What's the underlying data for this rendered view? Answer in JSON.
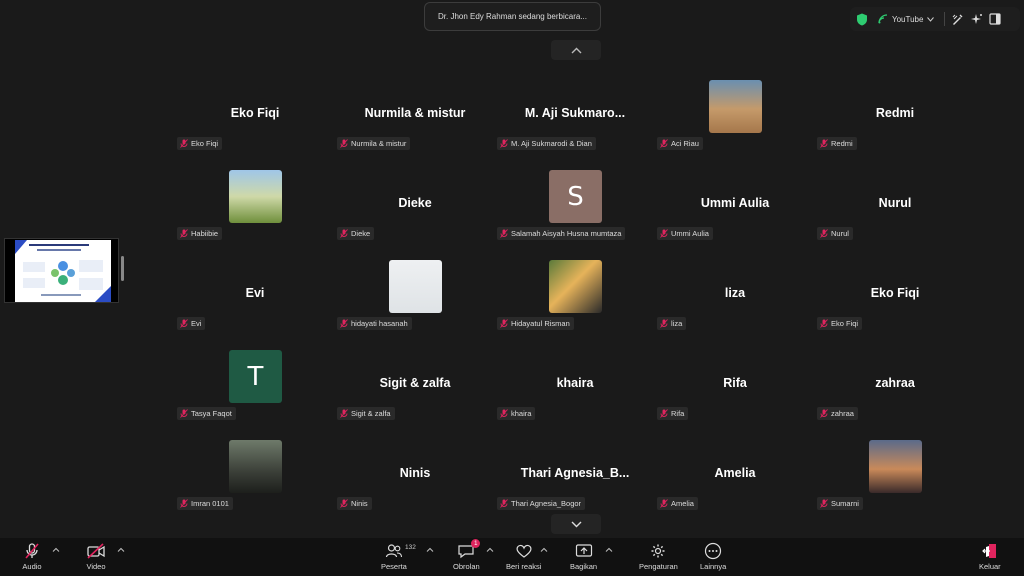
{
  "speaking_banner": "Dr. Jhon Edy Rahman sedang berbicara...",
  "top_bar": {
    "youtube_label": "YouTube"
  },
  "tiles": [
    {
      "name": "Eko Fiqi",
      "label": "Eko Fiqi",
      "avatar": "none"
    },
    {
      "name": "Nurmila & mistur",
      "label": "Nurmila & mistur",
      "avatar": "none"
    },
    {
      "name": "M. Aji Sukmaro...",
      "label": "M. Aji Sukmarodi & Dian",
      "avatar": "none"
    },
    {
      "name": "",
      "label": "Aci Riau",
      "avatar": "photo"
    },
    {
      "name": "Redmi",
      "label": "Redmi",
      "avatar": "none"
    },
    {
      "name": "",
      "label": "Habiibie",
      "avatar": "photo"
    },
    {
      "name": "Dieke",
      "label": "Dieke",
      "avatar": "none"
    },
    {
      "name": "",
      "label": "Salamah Aisyah Husna mumtaza",
      "avatar": "initial",
      "initial": "S",
      "color": "#8a6e66"
    },
    {
      "name": "Ummi Aulia",
      "label": "Ummi Aulia",
      "avatar": "none"
    },
    {
      "name": "Nurul",
      "label": "Nurul",
      "avatar": "none"
    },
    {
      "name": "Evi",
      "label": "Evi",
      "avatar": "none"
    },
    {
      "name": "",
      "label": "hidayati hasanah",
      "avatar": "photo"
    },
    {
      "name": "",
      "label": "Hidayatul Risman",
      "avatar": "photo"
    },
    {
      "name": "liza",
      "label": "liza",
      "avatar": "none"
    },
    {
      "name": "Eko Fiqi",
      "label": "Eko Fiqi",
      "avatar": "none"
    },
    {
      "name": "",
      "label": "Tasya Faqot",
      "avatar": "initial",
      "initial": "T",
      "color": "#1f5a44"
    },
    {
      "name": "Sigit & zalfa",
      "label": "Sigit & zalfa",
      "avatar": "none"
    },
    {
      "name": "khaira",
      "label": "khaira",
      "avatar": "none"
    },
    {
      "name": "Rifa",
      "label": "Rifa",
      "avatar": "none"
    },
    {
      "name": "zahraa",
      "label": "zahraa",
      "avatar": "none"
    },
    {
      "name": "",
      "label": "Imran 0101",
      "avatar": "photo"
    },
    {
      "name": "Ninis",
      "label": "Ninis",
      "avatar": "none"
    },
    {
      "name": "Thari  Agnesia_B...",
      "label": "Thari Agnesia_Bogor",
      "avatar": "none"
    },
    {
      "name": "Amelia",
      "label": "Amelia",
      "avatar": "none"
    },
    {
      "name": "",
      "label": "Sumarni",
      "avatar": "photo"
    }
  ],
  "toolbar": {
    "audio": "Audio",
    "video": "Video",
    "participants": "Peserta",
    "participant_count": "132",
    "chat": "Obrolan",
    "chat_badge": "1",
    "react": "Beri reaksi",
    "share": "Bagikan",
    "settings": "Pengaturan",
    "more": "Lainnya",
    "leave": "Keluar"
  },
  "colors": {
    "background": "#1a1a1a",
    "muted_red": "#e0245e",
    "shield_green": "#2ecc71"
  }
}
